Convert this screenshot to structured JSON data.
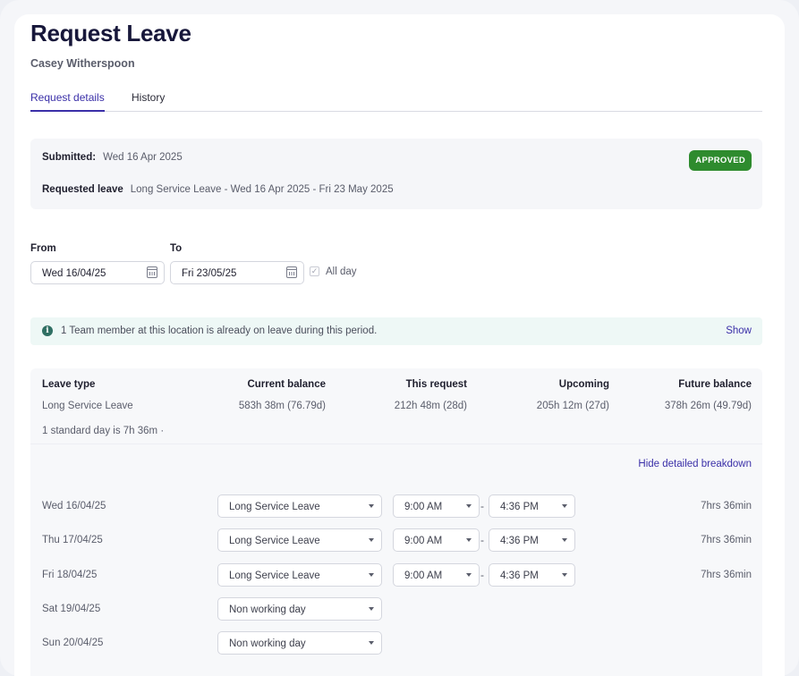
{
  "page": {
    "title": "Request Leave",
    "employee": "Casey Witherspoon"
  },
  "tabs": [
    {
      "label": "Request details",
      "active": true
    },
    {
      "label": "History",
      "active": false
    }
  ],
  "summary": {
    "submitted_label": "Submitted:",
    "submitted_value": "Wed 16 Apr 2025",
    "requested_label": "Requested leave",
    "requested_value": "Long Service Leave - Wed 16 Apr 2025 - Fri 23 May 2025",
    "status": "APPROVED",
    "status_color": "#2e8b2e"
  },
  "dates": {
    "from_label": "From",
    "from_value": "Wed 16/04/25",
    "to_label": "To",
    "to_value": "Fri 23/05/25",
    "all_day_label": "All day",
    "all_day_checked": true
  },
  "notice": {
    "text": "1 Team member at this location is already on leave during this period.",
    "action": "Show"
  },
  "balance": {
    "headers": [
      "Leave type",
      "Current balance",
      "This request",
      "Upcoming",
      "Future balance"
    ],
    "row": [
      "Long Service Leave",
      "583h 38m (76.79d)",
      "212h 48m (28d)",
      "205h 12m (27d)",
      "378h 26m (49.79d)"
    ],
    "standard_day": "1 standard day is 7h 36m ·",
    "toggle_label": "Hide detailed breakdown"
  },
  "breakdown": [
    {
      "date": "Wed 16/04/25",
      "type": "Long Service Leave",
      "start": "9:00 AM",
      "end": "4:36 PM",
      "duration": "7hrs 36min"
    },
    {
      "date": "Thu 17/04/25",
      "type": "Long Service Leave",
      "start": "9:00 AM",
      "end": "4:36 PM",
      "duration": "7hrs 36min"
    },
    {
      "date": "Fri 18/04/25",
      "type": "Long Service Leave",
      "start": "9:00 AM",
      "end": "4:36 PM",
      "duration": "7hrs 36min"
    },
    {
      "date": "Sat 19/04/25",
      "type": "Non working day"
    },
    {
      "date": "Sun 20/04/25",
      "type": "Non working day"
    }
  ],
  "colors": {
    "accent": "#3a2fa8",
    "heading": "#17173a",
    "info_bg": "#eef8f6"
  }
}
